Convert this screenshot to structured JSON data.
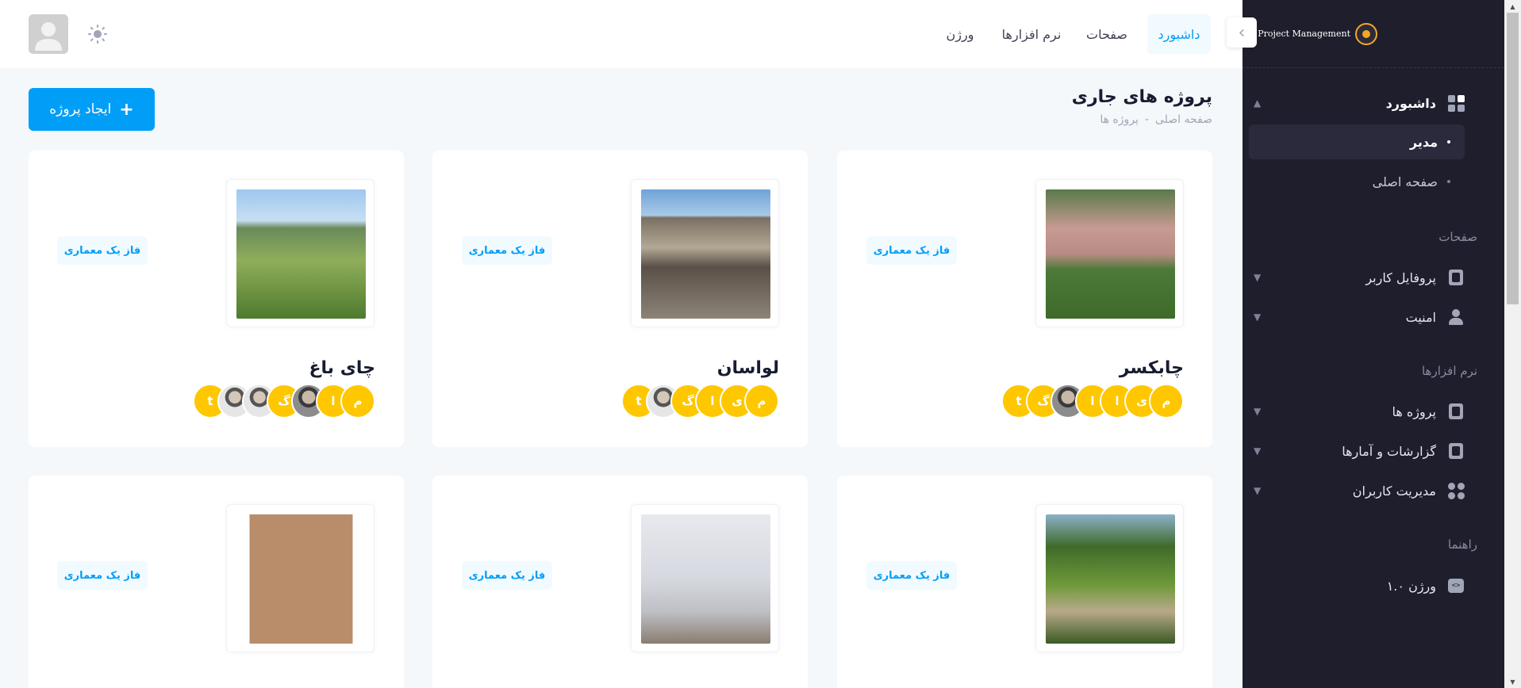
{
  "sidebar": {
    "brand": "Project Management",
    "dashboard": {
      "label": "داشبورد",
      "subitems": [
        {
          "label": "مدیر"
        },
        {
          "label": "صفحه اصلی"
        }
      ]
    },
    "section_pages": "صفحات",
    "pages": [
      {
        "label": "پروفایل کاربر"
      },
      {
        "label": "امنیت"
      }
    ],
    "section_software": "نرم افزارها",
    "software": [
      {
        "label": "پروژه ها"
      },
      {
        "label": "گزارشات و آمارها"
      },
      {
        "label": "مدیریت کاربران"
      }
    ],
    "section_guide": "راهنما",
    "guide": [
      {
        "label": "ورژن ۱.۰"
      }
    ]
  },
  "header": {
    "nav": [
      {
        "label": "داشبورد"
      },
      {
        "label": "صفحات"
      },
      {
        "label": "نرم افزارها"
      },
      {
        "label": "ورژن"
      }
    ]
  },
  "page": {
    "title": "پروژه های جاری",
    "breadcrumb": [
      "صفحه اصلی",
      "-",
      "پروژه ها"
    ],
    "create_button": "ایجاد پروژه"
  },
  "projects": [
    {
      "title": "چابکسر",
      "badge": "فاز یک معماری",
      "image": "villa",
      "members": [
        "م",
        "ی",
        "ا",
        "ا",
        "photo",
        "گ",
        "t"
      ]
    },
    {
      "title": "لواسان",
      "badge": "فاز یک معماری",
      "image": "construction",
      "members": [
        "م",
        "ی",
        "ا",
        "گ",
        "photo2",
        "t"
      ]
    },
    {
      "title": "چای باغ",
      "badge": "فاز یک معماری",
      "image": "aerial",
      "members": [
        "م",
        "ا",
        "photo",
        "گ",
        "photo2",
        "photo2",
        "t"
      ]
    },
    {
      "title": "",
      "badge": "فاز یک معماری",
      "image": "garden",
      "members": []
    },
    {
      "title": "",
      "badge": "فاز یک معماری",
      "image": "interior",
      "members": []
    },
    {
      "title": "",
      "badge": "فاز یک معماری",
      "image": "building",
      "members": []
    }
  ],
  "colors": {
    "accent": "#009ef7",
    "sidebar_bg": "#1e1e2d",
    "member_yellow": "#ffc700",
    "page_bg": "#f5f8fa"
  }
}
